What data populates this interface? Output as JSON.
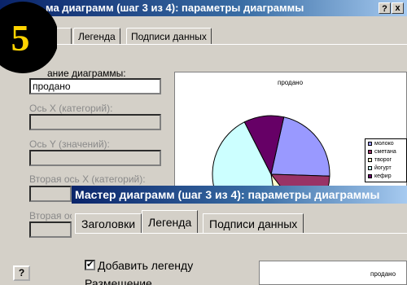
{
  "step_badge": "5",
  "back_dialog": {
    "title": "ма диаграмм (шаг 3 из 4): параметры диаграммы",
    "help": "?",
    "close": "x",
    "tabs": [
      {
        "label": ""
      },
      {
        "label": "Легенда"
      },
      {
        "label": "Подписи данных"
      }
    ],
    "chart_title_label": "ание диаграммы:",
    "chart_title_value": "продано",
    "axis_x_label": "Ось X (категорий):",
    "axis_y_label": "Ось Y (значений):",
    "second_axis_x_label": "Вторая ось X (категорий):",
    "second_axis_y_label": "Вторая ось Y",
    "help_button": "?"
  },
  "chart_data": {
    "type": "pie",
    "title": "продано",
    "categories": [
      "молоко",
      "сметана",
      "творог",
      "йогурт",
      "кефир"
    ],
    "values": [
      22,
      14,
      8,
      45,
      11
    ],
    "colors": [
      "#9999ff",
      "#993366",
      "#ffffcc",
      "#ccffff",
      "#660066"
    ],
    "legend": "right"
  },
  "front_dialog": {
    "title": "Мастер диаграмм (шаг 3 из 4): параметры диаграммы",
    "tabs": [
      {
        "label": "Заголовки"
      },
      {
        "label": "Легенда"
      },
      {
        "label": "Подписи данных"
      }
    ],
    "add_legend_label": "Добавить легенду",
    "add_legend_checked": "✔",
    "placement_label": "Размещение",
    "preview_title": "продано"
  }
}
